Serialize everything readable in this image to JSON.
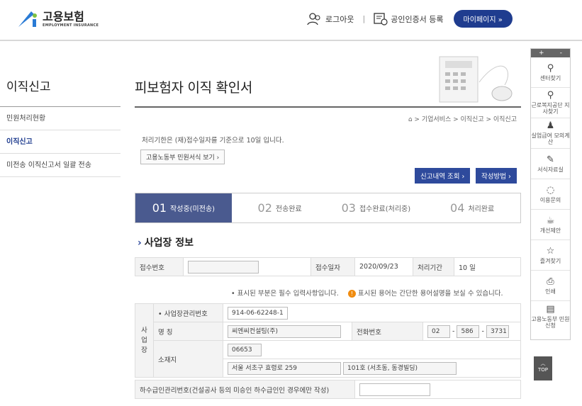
{
  "header": {
    "logo_ko": "고용보험",
    "logo_en": "EMPLOYMENT INSURANCE",
    "logout": "로그아웃",
    "cert": "공인인증서 등록",
    "mypage": "마이페이지  »"
  },
  "lnb": {
    "title": "이직신고",
    "items": [
      "민원처리현황",
      "이직신고",
      "미전송 이직신고서 일괄 전송"
    ]
  },
  "page": {
    "title": "피보험자 이직 확인서",
    "breadcrumb": "⌂ > 기업서비스 > 이직신고 > 이직신고",
    "notice": "처리기한은 (재)접수일자를 기준으로 10일 입니다.",
    "form_link": "고용노동부 민원서식 보기 ›",
    "btn_history": "신고내역 조회 ›",
    "btn_method": "작성방법 ›"
  },
  "steps": [
    {
      "num": "01",
      "label": "작성중(미전송)"
    },
    {
      "num": "02",
      "label": "전송완료"
    },
    {
      "num": "03",
      "label": "접수완료(처리중)"
    },
    {
      "num": "04",
      "label": "처리완료"
    }
  ],
  "section": {
    "title": "사업장 정보",
    "receipt_no_label": "접수번호",
    "receipt_date_label": "접수일자",
    "receipt_date": "2020/09/23",
    "period_label": "처리기간",
    "period": "10 일",
    "req_note": "• 표시된 부분은 필수 입력사항입니다.",
    "help_note": "표시된 용어는 간단한 용어설명을 보실 수 있습니다.",
    "vert_label": "사업장",
    "mgmt_no_label": "• 사업장관리번호",
    "mgmt_no": "914-06-62248-1",
    "name_label": "명 칭",
    "name": "씨엔씨컨설팅(주)",
    "phone_label": "전화번호",
    "phone1": "02",
    "phone2": "586",
    "phone3": "3731",
    "addr_label": "소재지",
    "zip": "06653",
    "addr1": "서울 서초구 효령로 259",
    "addr2": "101호 (서초동, 동경빌딩)",
    "sub_label": "하수급인관리번호(건설공사 등의 미승인 하수급인인 경우에만 작성)"
  },
  "quick": {
    "items": [
      "센터찾기",
      "근로복지공단 지사찾기",
      "실업급여 모의계산",
      "서식자료실",
      "이용문의",
      "개선제안",
      "즐겨찾기",
      "인쇄",
      "고용노동부 민원신청"
    ],
    "top": "TOP"
  },
  "colors": {
    "primary": "#1f3c8f",
    "step_active": "#4a5a8f",
    "accent": "#f08c10"
  }
}
